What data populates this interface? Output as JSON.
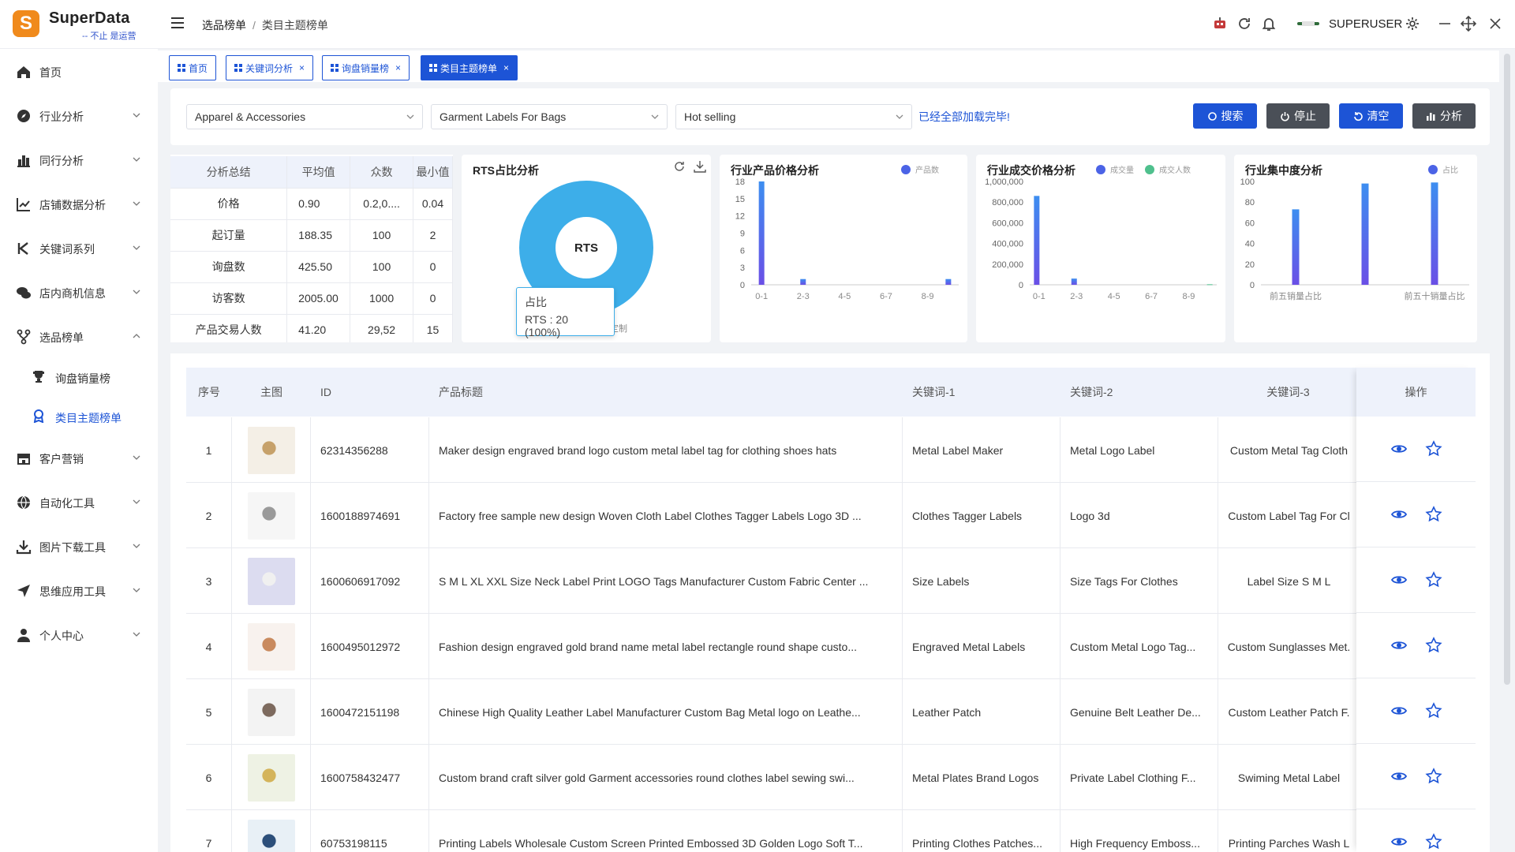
{
  "app": {
    "name": "SuperData",
    "slogan": "-- 不止 是运营",
    "logo_letter": "S",
    "accent": "#1d54d6"
  },
  "breadcrumb": {
    "parent": "选品榜单",
    "current": "类目主题榜单"
  },
  "header": {
    "username": "SUPERUSER"
  },
  "sidebar": {
    "items": [
      {
        "label": "首页",
        "icon": "home-icon"
      },
      {
        "label": "行业分析",
        "icon": "compass-icon"
      },
      {
        "label": "同行分析",
        "icon": "bar-chart-icon"
      },
      {
        "label": "店铺数据分析",
        "icon": "line-chart-icon"
      },
      {
        "label": "关键词系列",
        "icon": "k-icon"
      },
      {
        "label": "店内商机信息",
        "icon": "chat-icon"
      },
      {
        "label": "选品榜单",
        "icon": "fork-icon"
      },
      {
        "label": "客户营销",
        "icon": "store-icon"
      },
      {
        "label": "自动化工具",
        "icon": "globe-icon"
      },
      {
        "label": "图片下载工具",
        "icon": "download-icon"
      },
      {
        "label": "思维应用工具",
        "icon": "send-icon"
      },
      {
        "label": "个人中心",
        "icon": "user-icon"
      }
    ],
    "subitems": [
      {
        "label": "询盘销量榜",
        "icon": "trophy-icon"
      },
      {
        "label": "类目主题榜单",
        "icon": "badge-icon"
      }
    ]
  },
  "tabs": [
    {
      "label": "首页"
    },
    {
      "label": "关键词分析"
    },
    {
      "label": "询盘销量榜"
    },
    {
      "label": "类目主题榜单"
    }
  ],
  "filters": {
    "category": "Apparel & Accessories",
    "subcategory": "Garment Labels For Bags",
    "sort": "Hot selling",
    "loaded_msg": "已经全部加载完毕!",
    "buttons": {
      "search": "搜索",
      "stop": "停止",
      "clear": "清空",
      "analyze": "分析"
    }
  },
  "stats": {
    "headers": [
      "分析总结",
      "平均值",
      "众数",
      "最小值"
    ],
    "rows": [
      [
        "价格",
        "0.90",
        "0.2,0....",
        "0.04"
      ],
      [
        "起订量",
        "188.35",
        "100",
        "2"
      ],
      [
        "询盘数",
        "425.50",
        "100",
        "0"
      ],
      [
        "访客数",
        "2005.00",
        "1000",
        "0"
      ],
      [
        "产品交易人数",
        "41.20",
        "29,52",
        "15"
      ]
    ]
  },
  "rts": {
    "title": "RTS占比分析",
    "center": "RTS",
    "tooltip_title": "占比",
    "tooltip_value": "RTS : 20 (100%)",
    "legend_hint": "定制",
    "color": "#3daee9"
  },
  "chart_data": [
    {
      "type": "bar",
      "title": "行业产品价格分析",
      "legend": [
        "产品数"
      ],
      "categories": [
        "0-1",
        "1-2",
        "2-3",
        "3-4",
        "4-5",
        "5-6",
        "6-7",
        "7-8",
        "8-9",
        "9-10"
      ],
      "series": [
        {
          "name": "产品数",
          "values": [
            18,
            0,
            1,
            0,
            0,
            0,
            0,
            0,
            0,
            1
          ]
        }
      ],
      "ylim": [
        0,
        18
      ],
      "yticks": [
        "18",
        "15",
        "12",
        "9",
        "6",
        "3",
        "0"
      ],
      "xticks": [
        "0-1",
        "2-3",
        "4-5",
        "6-7",
        "8-9"
      ]
    },
    {
      "type": "bar",
      "title": "行业成交价格分析",
      "legend": [
        "成交量",
        "成交人数"
      ],
      "categories": [
        "0-1",
        "1-2",
        "2-3",
        "3-4",
        "4-5",
        "5-6",
        "6-7",
        "7-8",
        "8-9",
        "9-10"
      ],
      "series": [
        {
          "name": "成交量",
          "values": [
            860000,
            0,
            60000,
            0,
            0,
            0,
            0,
            0,
            0,
            0
          ]
        },
        {
          "name": "成交人数",
          "values": [
            0,
            0,
            0,
            0,
            0,
            0,
            0,
            0,
            0,
            5000
          ]
        }
      ],
      "ylim": [
        0,
        1000000
      ],
      "yticks": [
        "1,000,000",
        "800,000",
        "600,000",
        "400,000",
        "200,000",
        "0"
      ],
      "xticks": [
        "0-1",
        "2-3",
        "4-5",
        "6-7",
        "8-9"
      ]
    },
    {
      "type": "bar",
      "title": "行业集中度分析",
      "legend": [
        "占比"
      ],
      "categories": [
        "前五销量占比",
        "前十销量占比",
        "前五十销量占比"
      ],
      "series": [
        {
          "name": "占比",
          "values": [
            73,
            98,
            99
          ]
        }
      ],
      "ylim": [
        0,
        100
      ],
      "yticks": [
        "100",
        "80",
        "60",
        "40",
        "20",
        "0"
      ],
      "xticks": [
        "前五销量占比",
        "前五十销量占比"
      ]
    }
  ],
  "table": {
    "headers": [
      "序号",
      "主图",
      "ID",
      "产品标题",
      "关键词-1",
      "关键词-2",
      "关键词-3",
      "操作"
    ],
    "rows": [
      {
        "no": "1",
        "id": "62314356288",
        "title": "Maker design engraved brand logo custom metal label tag for clothing shoes hats",
        "k1": "Metal Label Maker",
        "k2": "Metal Logo Label",
        "k3": "Custom Metal Tag Cloth"
      },
      {
        "no": "2",
        "id": "1600188974691",
        "title": "Factory free sample new design Woven Cloth Label Clothes Tagger Labels Logo 3D ...",
        "k1": "Clothes Tagger Labels",
        "k2": "Logo 3d",
        "k3": "Custom Label Tag For Cl"
      },
      {
        "no": "3",
        "id": "1600606917092",
        "title": "S M L XL XXL Size Neck Label Print LOGO Tags Manufacturer Custom Fabric Center ...",
        "k1": "Size Labels",
        "k2": "Size Tags For Clothes",
        "k3": "Label Size S M L"
      },
      {
        "no": "4",
        "id": "1600495012972",
        "title": "Fashion design engraved gold brand name metal label rectangle round shape custo...",
        "k1": "Engraved Metal Labels",
        "k2": "Custom Metal Logo Tag...",
        "k3": "Custom Sunglasses Met."
      },
      {
        "no": "5",
        "id": "1600472151198",
        "title": "Chinese High Quality Leather Label Manufacturer Custom Bag Metal logo on Leathe...",
        "k1": "Leather Patch",
        "k2": "Genuine Belt Leather De...",
        "k3": "Custom Leather Patch F."
      },
      {
        "no": "6",
        "id": "1600758432477",
        "title": "Custom brand craft silver gold Garment accessories round clothes label sewing swi...",
        "k1": "Metal Plates Brand Logos",
        "k2": "Private Label Clothing F...",
        "k3": "Swiming Metal Label"
      },
      {
        "no": "7",
        "id": "60753198115",
        "title": "Printing Labels Wholesale Custom Screen Printed Embossed 3D Golden Logo Soft T...",
        "k1": "Printing Clothes Patches...",
        "k2": "High Frequency Emboss...",
        "k3": "Printing Parches Wash L"
      }
    ]
  }
}
